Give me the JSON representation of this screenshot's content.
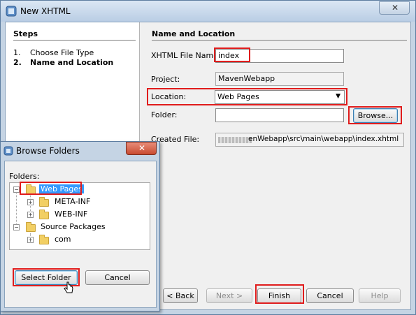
{
  "window": {
    "title": "New XHTML",
    "close_glyph": "✕",
    "icon": "netbeans-icon"
  },
  "steps": {
    "heading": "Steps",
    "items": [
      {
        "number": "1.",
        "label": "Choose File Type",
        "current": false
      },
      {
        "number": "2.",
        "label": "Name and Location",
        "current": true
      }
    ]
  },
  "form": {
    "heading": "Name and Location",
    "file_name_label": "XHTML File Name:",
    "file_name_value": "index",
    "project_label": "Project:",
    "project_value": "MavenWebapp",
    "location_label": "Location:",
    "location_value": "Web Pages",
    "folder_label": "Folder:",
    "folder_value": "",
    "browse_label": "Browse...",
    "created_file_label": "Created File:",
    "created_file_value": "enWebapp\\src\\main\\webapp\\index.xhtml"
  },
  "buttons": {
    "back": "< Back",
    "next": "Next >",
    "finish": "Finish",
    "cancel": "Cancel",
    "help": "Help"
  },
  "browse_dialog": {
    "title": "Browse Folders",
    "close_glyph": "✕",
    "folders_label": "Folders:",
    "tree": {
      "web_pages": "Web Pages",
      "meta_inf": "META-INF",
      "web_inf": "WEB-INF",
      "source_packages": "Source Packages",
      "com": "com"
    },
    "expand_glyph": "+",
    "collapse_glyph": "−",
    "select_folder": "Select Folder",
    "cancel": "Cancel"
  },
  "colors": {
    "highlight": "#e01c1c",
    "selection": "#3399ff"
  }
}
